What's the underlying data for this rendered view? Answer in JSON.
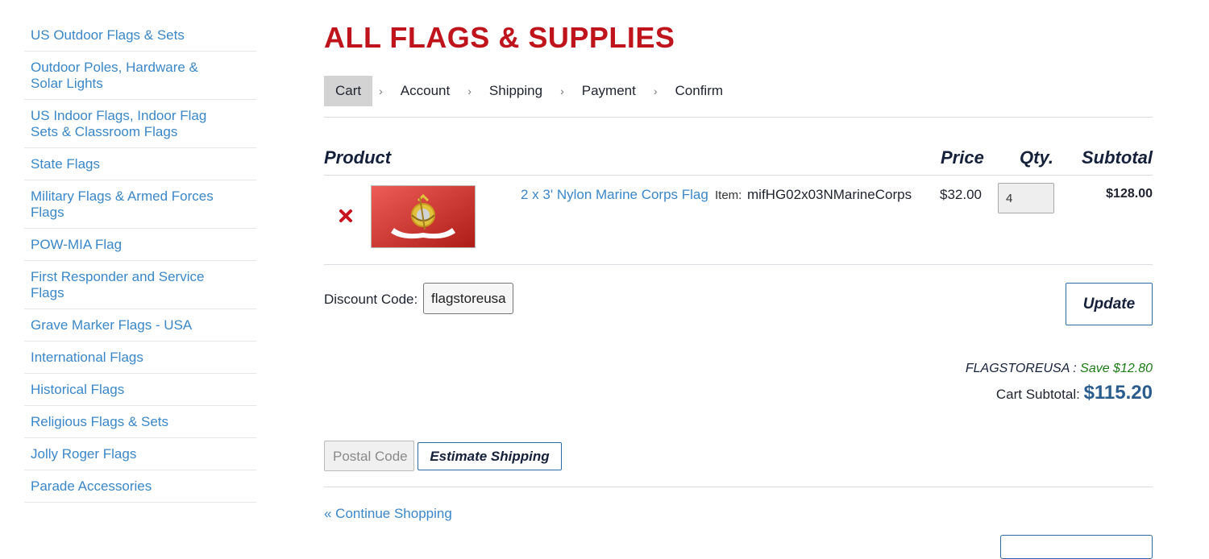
{
  "sidebar": {
    "items": [
      {
        "label": "US Outdoor Flags & Sets"
      },
      {
        "label": "Outdoor Poles, Hardware & Solar Lights"
      },
      {
        "label": "US Indoor Flags, Indoor Flag Sets & Classroom Flags"
      },
      {
        "label": "State Flags"
      },
      {
        "label": "Military Flags & Armed Forces Flags"
      },
      {
        "label": "POW-MIA Flag"
      },
      {
        "label": "First Responder and Service Flags"
      },
      {
        "label": "Grave Marker Flags - USA"
      },
      {
        "label": "International Flags"
      },
      {
        "label": "Historical Flags"
      },
      {
        "label": "Religious Flags & Sets"
      },
      {
        "label": "Jolly Roger Flags"
      },
      {
        "label": "Parade Accessories"
      }
    ]
  },
  "page": {
    "title": "ALL FLAGS & SUPPLIES"
  },
  "checkout_steps": {
    "separator": "›",
    "steps": [
      {
        "label": "Cart",
        "active": true
      },
      {
        "label": "Account"
      },
      {
        "label": "Shipping"
      },
      {
        "label": "Payment"
      },
      {
        "label": "Confirm"
      }
    ]
  },
  "cart": {
    "headers": {
      "product": "Product",
      "price": "Price",
      "qty": "Qty.",
      "subtotal": "Subtotal"
    },
    "items": [
      {
        "name": "2 x 3' Nylon Marine Corps Flag",
        "item_label": "Item:",
        "sku": "mifHG02x03NMarineCorps",
        "price": "$32.00",
        "qty": "4",
        "subtotal": "$128.00",
        "image_icon": "marine-corps-flag"
      }
    ],
    "discount": {
      "label": "Discount Code:",
      "value": "flagstoreusa"
    },
    "update_label": "Update",
    "savings": {
      "code": "FLAGSTOREUSA",
      "separator": " : ",
      "text": "Save $12.80"
    },
    "subtotal": {
      "label": "Cart Subtotal:",
      "amount": "$115.20"
    },
    "shipping": {
      "postal_placeholder": "Postal Code",
      "estimate_label": "Estimate Shipping"
    },
    "continue_label": "« Continue Shopping"
  },
  "colors": {
    "title": "#c0141c",
    "link": "#3a87c9",
    "savings": "#1c7c16",
    "subtotal_amount": "#2a5d8e",
    "button_border": "#2b6aa8"
  }
}
